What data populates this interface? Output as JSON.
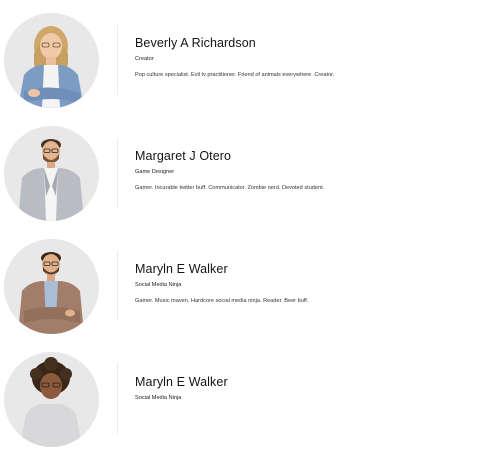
{
  "team": [
    {
      "name": "Beverly A Richardson",
      "role": "Creator",
      "bio": "Pop culture specialist. Evil tv practitioner. Friend of animals everywhere. Creator.",
      "avatar_icon": "woman-blonde-denim-portrait"
    },
    {
      "name": "Margaret J Otero",
      "role": "Game Designer",
      "bio": "Gamer. Incurable twitter buff. Communicator. Zombie nerd. Devoted student.",
      "avatar_icon": "man-grey-blazer-portrait"
    },
    {
      "name": "Maryln E Walker",
      "role": "Social Media Ninja",
      "bio": "Gamer. Music maven. Hardcore social media ninja. Reader. Beer buff.",
      "avatar_icon": "man-brown-blazer-portrait"
    },
    {
      "name": "Maryln E Walker",
      "role": "Social Media Ninja",
      "bio": "",
      "avatar_icon": "man-curly-hair-portrait"
    }
  ],
  "colors": {
    "avatar_bg": "#e9e9ea",
    "divider": "#ececec",
    "name_text": "#141414"
  }
}
